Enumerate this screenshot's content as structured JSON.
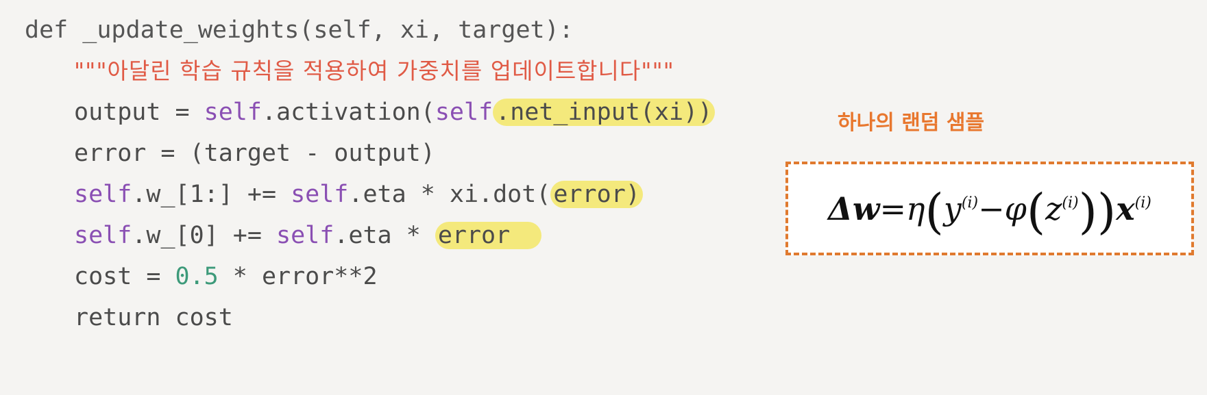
{
  "code": {
    "line1": "def _update_weights(self, xi, target):",
    "docstring": "\"\"\"아달린 학습 규칙을 적용하여 가중치를 업데이트합니다\"\"\"",
    "line3_a": "output = ",
    "line3_self1": "self",
    "line3_b": ".activation(",
    "line3_self2": "self",
    "line3_hl": ".net_input(xi))",
    "line4": "error = (target - output)",
    "line5_self1": "self",
    "line5_a": ".w_[1:] += ",
    "line5_self2": "self",
    "line5_b": ".eta * xi.dot(",
    "line5_hl": "error)",
    "line6_self1": "self",
    "line6_a": ".w_[0] += ",
    "line6_self2": "self",
    "line6_b": ".eta * ",
    "line6_hl": "error  ",
    "line7_a": "cost = ",
    "line7_num": "0.5",
    "line7_b": " * error**2",
    "line8": "return cost"
  },
  "annotation": {
    "label": "하나의 랜덤 샘플"
  },
  "formula": {
    "delta_w": "Δw",
    "eq": " = ",
    "eta": "η",
    "y": "y",
    "sup_i": "(i)",
    "minus": " − ",
    "phi": "φ",
    "z": "z",
    "x": "x",
    "lparen": "(",
    "rparen": ")"
  },
  "colors": {
    "highlight": "#f4e97c",
    "docstring": "#e05a45",
    "self": "#8a4fb3",
    "number": "#3d9a7a",
    "accent": "#e07a2f"
  }
}
